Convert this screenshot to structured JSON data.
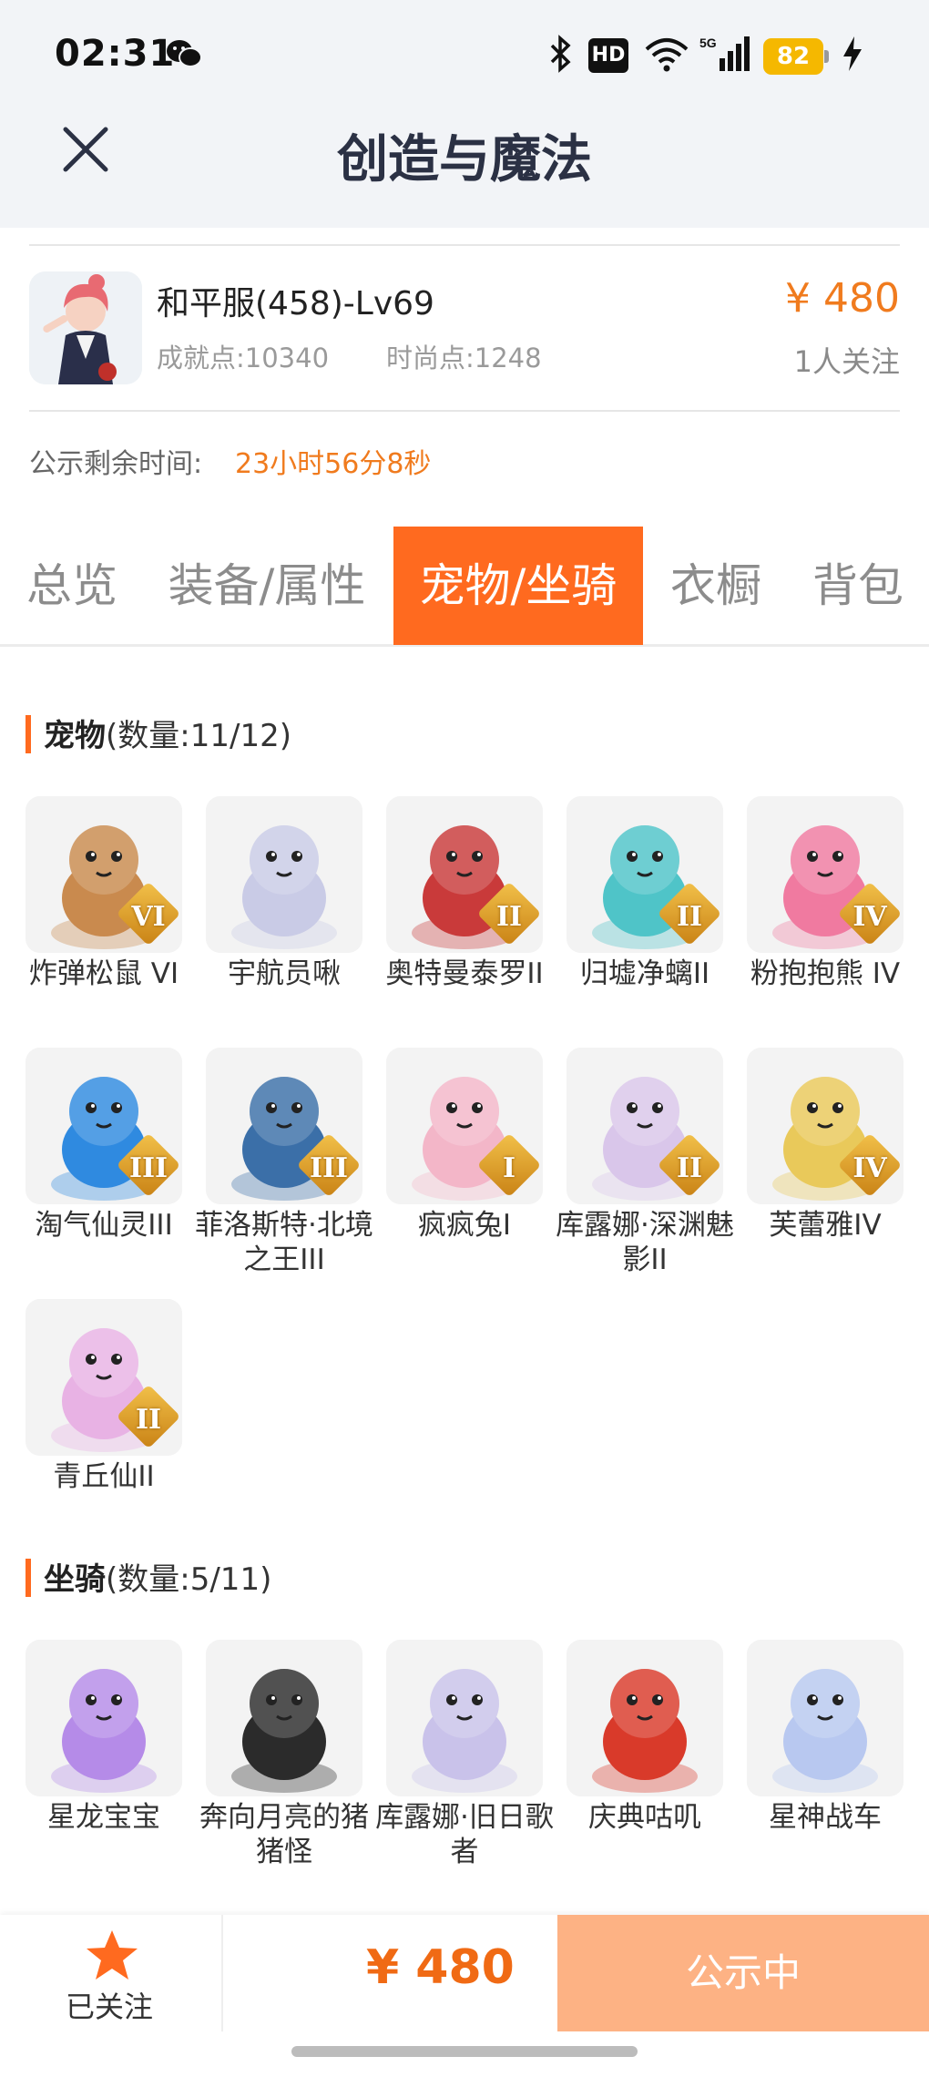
{
  "status_bar": {
    "time": "02:31",
    "hd_label": "HD",
    "network_label": "5G",
    "battery": "82"
  },
  "header": {
    "title": "创造与魔法"
  },
  "item": {
    "name": "和平服(458)-Lv69",
    "achievement": "成就点:10340",
    "fashion": "时尚点:1248",
    "price": "¥ 480",
    "followers": "1人关注",
    "notice_label": "公示剩余时间:",
    "notice_value": "23小时56分8秒"
  },
  "tabs": [
    {
      "label": "总览"
    },
    {
      "label": "装备/属性"
    },
    {
      "label": "宠物/坐骑",
      "active": true
    },
    {
      "label": "衣橱"
    },
    {
      "label": "背包"
    }
  ],
  "pets": {
    "title": "宠物",
    "count": "(数量:11/12)",
    "items": [
      {
        "name": "炸弹松鼠 VI",
        "grade": "VI",
        "color": "#c98a4e",
        "icon": "squirrel"
      },
      {
        "name": "宇航员啾",
        "grade": "",
        "color": "#c9cbe6",
        "icon": "astronaut"
      },
      {
        "name": "奥特曼泰罗II",
        "grade": "II",
        "color": "#c93a3a",
        "icon": "ultraman"
      },
      {
        "name": "归墟净螭II",
        "grade": "II",
        "color": "#4fc4c8",
        "icon": "dragon"
      },
      {
        "name": "粉抱抱熊 IV",
        "grade": "IV",
        "color": "#f07aa0",
        "icon": "bear"
      },
      {
        "name": "淘气仙灵III",
        "grade": "III",
        "color": "#2f8ae0",
        "icon": "puppy"
      },
      {
        "name": "菲洛斯特·北境之王III",
        "grade": "III",
        "color": "#3b6fa8",
        "icon": "ice-king"
      },
      {
        "name": "疯疯兔I",
        "grade": "I",
        "color": "#f3b6c8",
        "icon": "rabbit"
      },
      {
        "name": "库露娜·深渊魅影II",
        "grade": "II",
        "color": "#d9c6ea",
        "icon": "kuluna"
      },
      {
        "name": "芙蕾雅IV",
        "grade": "IV",
        "color": "#e9c95a",
        "icon": "freya"
      },
      {
        "name": "青丘仙II",
        "grade": "II",
        "color": "#e8b2e4",
        "icon": "fox-fairy"
      }
    ]
  },
  "mounts": {
    "title": "坐骑",
    "count": "(数量:5/11)",
    "items": [
      {
        "name": "星龙宝宝",
        "color": "#b58be8",
        "icon": "star-dragon"
      },
      {
        "name": "奔向月亮的猪猪怪",
        "color": "#2b2b2b",
        "icon": "pig"
      },
      {
        "name": "库露娜·旧日歌者",
        "color": "#c9c2ea",
        "icon": "kuluna-singer"
      },
      {
        "name": "庆典咕叽",
        "color": "#d93a2a",
        "icon": "festival"
      },
      {
        "name": "星神战车",
        "color": "#b8c8f0",
        "icon": "unicorn"
      }
    ]
  },
  "bottom": {
    "follow_label": "已关注",
    "price": "¥ 480",
    "button": "公示中"
  },
  "colors": {
    "accent": "#ff6a1f",
    "price": "#f07b1e",
    "button_bg": "#fdb284"
  }
}
